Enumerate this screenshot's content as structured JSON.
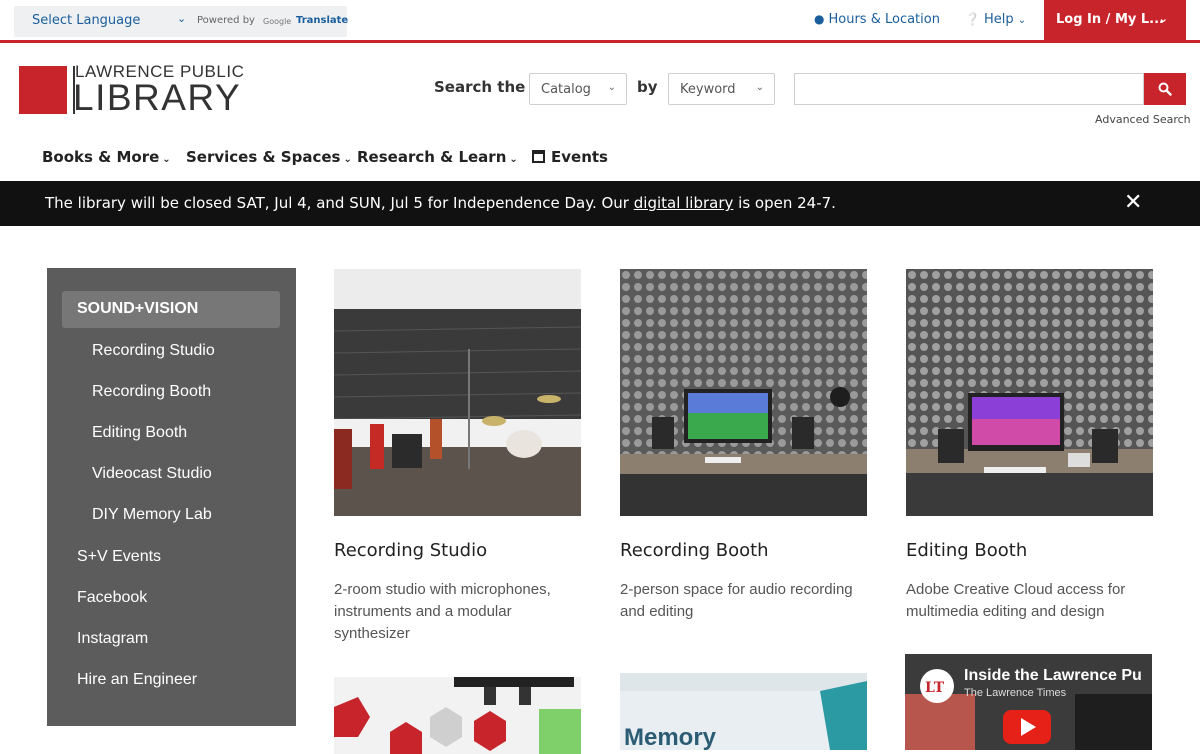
{
  "translate": {
    "select_language": "Select Language",
    "powered_by": "Powered by",
    "google": "Google",
    "translate": "Translate"
  },
  "utility": {
    "hours": "Hours & Location",
    "help": "Help",
    "login": "Log In / My L..."
  },
  "logo": {
    "line1": "LAWRENCE PUBLIC",
    "line2": "LIBRARY"
  },
  "search": {
    "label": "Search the",
    "scope": "Catalog",
    "by": "by",
    "type": "Keyword",
    "query": "",
    "advanced": "Advanced Search"
  },
  "nav": {
    "books": "Books & More",
    "services": "Services & Spaces",
    "research": "Research & Learn",
    "events": "Events"
  },
  "alert": {
    "before": "The library will be closed SAT, Jul 4, and SUN, Jul 5 for Independence Day. Our ",
    "link": "digital library",
    "after": " is open 24-7."
  },
  "sidebar": {
    "heading": "SOUND+VISION",
    "items": [
      "Recording Studio",
      "Recording Booth",
      "Editing Booth",
      "Videocast Studio",
      "DIY Memory Lab",
      "S+V Events",
      "Facebook",
      "Instagram",
      "Hire an Engineer"
    ]
  },
  "cards": [
    {
      "title": "Recording Studio",
      "desc": "2-room studio with microphones, instruments and a modular synthesizer"
    },
    {
      "title": "Recording Booth",
      "desc": "2-person space for audio recording and editing"
    },
    {
      "title": "Editing Booth",
      "desc": "Adobe Creative Cloud access for multimedia editing and design"
    }
  ],
  "lower": {
    "memory_sign": "Memory",
    "video_title": "Inside the Lawrence Pu",
    "video_channel": "The Lawrence Times",
    "video_logo": "LT"
  }
}
